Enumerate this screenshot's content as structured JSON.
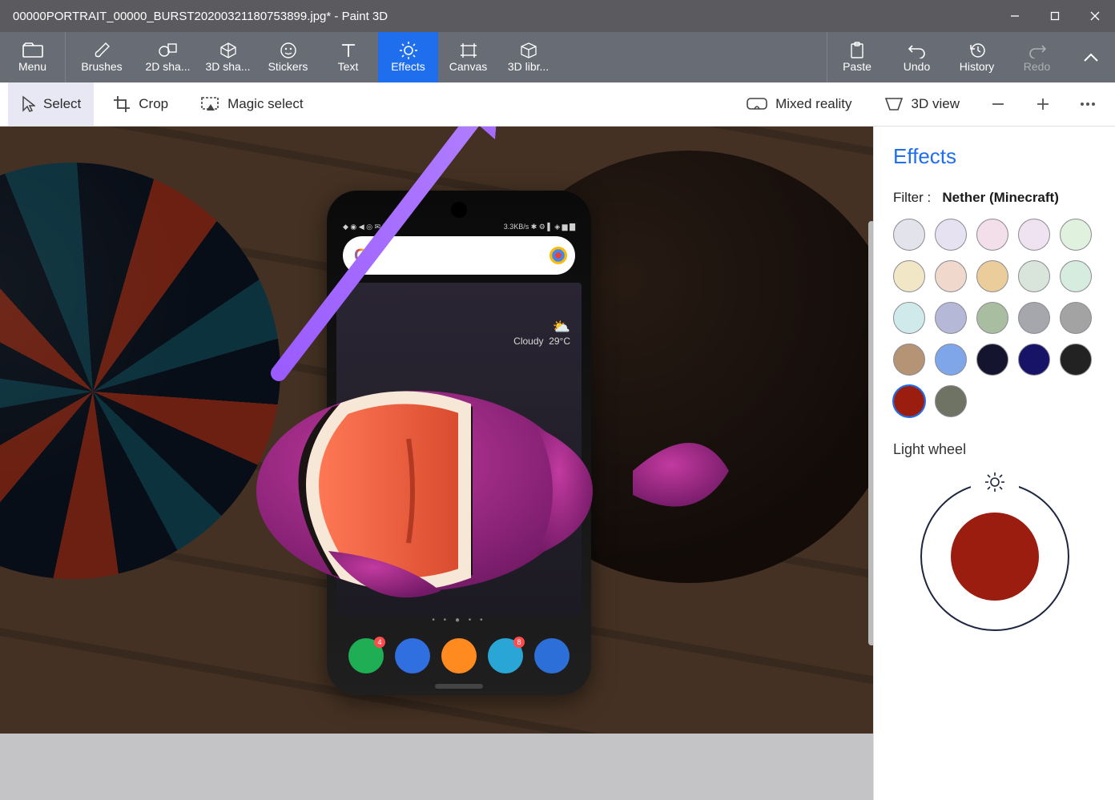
{
  "window": {
    "title": "00000PORTRAIT_00000_BURST20200321180753899.jpg* - Paint 3D"
  },
  "ribbon": {
    "menu": "Menu",
    "items": [
      {
        "id": "brushes",
        "label": "Brushes"
      },
      {
        "id": "2d",
        "label": "2D sha..."
      },
      {
        "id": "3d",
        "label": "3D sha..."
      },
      {
        "id": "stickers",
        "label": "Stickers"
      },
      {
        "id": "text",
        "label": "Text"
      },
      {
        "id": "effects",
        "label": "Effects",
        "active": true
      },
      {
        "id": "canvas",
        "label": "Canvas"
      },
      {
        "id": "3dlib",
        "label": "3D libr..."
      }
    ],
    "right": [
      {
        "id": "paste",
        "label": "Paste"
      },
      {
        "id": "undo",
        "label": "Undo"
      },
      {
        "id": "history",
        "label": "History"
      },
      {
        "id": "redo",
        "label": "Redo",
        "disabled": true
      }
    ]
  },
  "toolbar": {
    "select": "Select",
    "crop": "Crop",
    "magic": "Magic select",
    "mixed": "Mixed reality",
    "view3d": "3D view"
  },
  "panel": {
    "title": "Effects",
    "filter_label": "Filter :",
    "filter_name": "Nether (Minecraft)",
    "swatches": [
      "#e2e3eb",
      "#e7e2f1",
      "#f3dfe9",
      "#efe3f1",
      "#e0f1de",
      "#f1e6c6",
      "#f0d8cc",
      "#eacd9a",
      "#d9e5db",
      "#d5ecdf",
      "#d0eaeb",
      "#b5b8d7",
      "#a9bda0",
      "#a6a6ad",
      "#a3a3a3",
      "#b49474",
      "#7ea6e8",
      "#14142e",
      "#171467",
      "#222222",
      "#9a1d10",
      "#6f7363"
    ],
    "selected_swatch_index": 20,
    "light_label": "Light wheel",
    "light_center_color": "#9a1d10"
  },
  "scene": {
    "weather_text": "Cloudy",
    "weather_temp": "29°C",
    "status_left": "◆ ◉ ◀ ◎ ✉ ☰ ⋯",
    "status_right": "3.3KB/s ✱ ⚙ ▌ ◈ ▆ ▇",
    "search_letter": "G",
    "dock_badges": [
      "4",
      "",
      "",
      "8",
      ""
    ],
    "dock_colors": [
      "#1fae54",
      "#2f6fe0",
      "#ff8a1f",
      "#2aa6d6",
      "#2d6fd9"
    ]
  }
}
